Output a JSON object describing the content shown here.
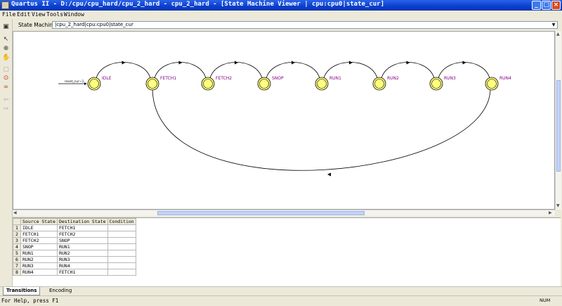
{
  "window": {
    "title": "Quartus II - D:/cpu/cpu_hard/cpu_2_hard - cpu_2_hard - [State Machine Viewer | cpu:cpu0|state_cur]"
  },
  "menu": [
    "File",
    "Edit",
    "View",
    "Tools",
    "Window"
  ],
  "header": {
    "label": "State Machine:",
    "selected": "|cpu_2_hard|cpu:cpu0|state_cur"
  },
  "diagram": {
    "reset_label": "reset_cur~1",
    "states": [
      "IDLE",
      "FETCH1",
      "FETCH2",
      "SNOP",
      "RUN1",
      "RUN2",
      "RUN3",
      "RUN4"
    ],
    "state_color": "#ffff80",
    "label_color": "#800080"
  },
  "table": {
    "headers": [
      "Source State",
      "Destination State",
      "Condition"
    ],
    "rows": [
      [
        "1",
        "IDLE",
        "FETCH1",
        ""
      ],
      [
        "2",
        "FETCH1",
        "FETCH2",
        ""
      ],
      [
        "3",
        "FETCH2",
        "SNOP",
        ""
      ],
      [
        "4",
        "SNOP",
        "RUN1",
        ""
      ],
      [
        "5",
        "RUN1",
        "RUN2",
        ""
      ],
      [
        "6",
        "RUN2",
        "RUN3",
        ""
      ],
      [
        "7",
        "RUN3",
        "RUN4",
        ""
      ],
      [
        "8",
        "RUN4",
        "FETCH1",
        ""
      ]
    ]
  },
  "tabs": [
    "Transitions",
    "Encoding"
  ],
  "status": {
    "message": "For Help, press F1",
    "indicator": "NUM"
  }
}
